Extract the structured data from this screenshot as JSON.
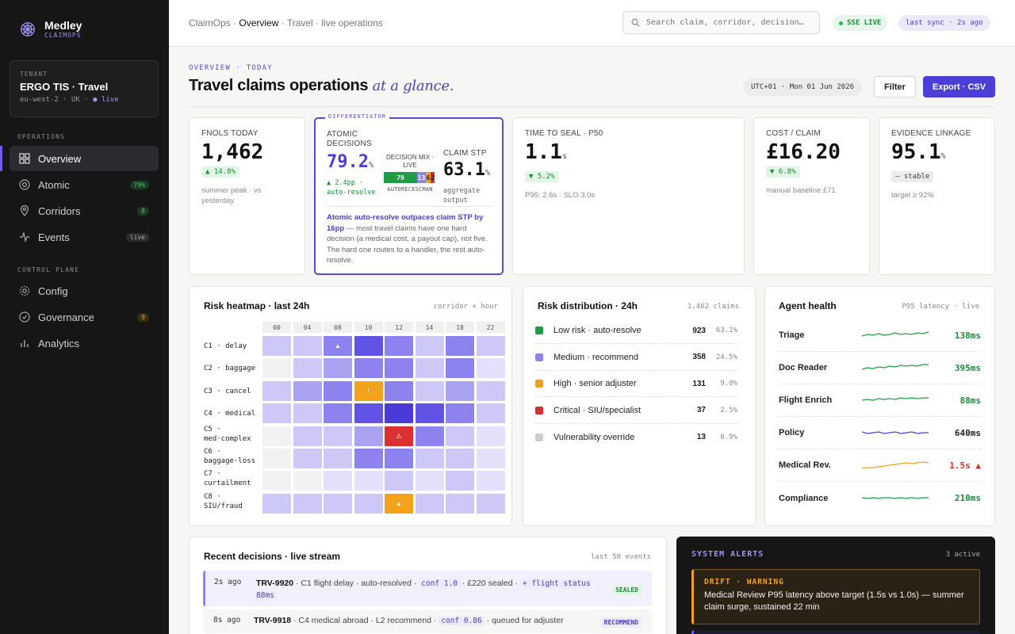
{
  "brand": {
    "name": "Medley",
    "sub": "CLAIMOPS"
  },
  "tenant": {
    "label": "TENANT",
    "name": "ERGO TIS · Travel",
    "region": "eu-west-2 · UK · ",
    "status": "live"
  },
  "nav": {
    "sections": [
      "OPERATIONS",
      "CONTROL PLANE"
    ],
    "items": [
      {
        "label": "Overview",
        "icon": "grid-icon"
      },
      {
        "label": "Atomic",
        "icon": "target-icon",
        "badge": "79%"
      },
      {
        "label": "Corridors",
        "icon": "pin-icon",
        "badge": "8"
      },
      {
        "label": "Events",
        "icon": "pulse-icon",
        "badge": "live"
      },
      {
        "label": "Config",
        "icon": "gear-icon"
      },
      {
        "label": "Governance",
        "icon": "check-circle-icon",
        "badge": "9"
      },
      {
        "label": "Analytics",
        "icon": "bar-chart-icon"
      }
    ]
  },
  "header": {
    "crumb_root": "ClaimOps ·",
    "crumb_current": "Overview",
    "crumb_tail": "· Travel · live operations",
    "search_placeholder": "Search claim, corridor, decision…",
    "live_pill": "SSE LIVE",
    "sync_pill": "last sync · 2s ago"
  },
  "page": {
    "eyebrow": "OVERVIEW · TODAY",
    "title": "Travel claims operations",
    "title_italic": "at a glance.",
    "date": "UTC+01 · Mon 01 Jun 2026",
    "filter_label": "Filter",
    "export_label": "Export · CSV"
  },
  "kpis": {
    "fnols": {
      "label": "FNOLS TODAY",
      "value": "1,462",
      "delta": "▲ 14.8%",
      "note": "summer peak · vs yesterday"
    },
    "atomic": {
      "tag": "DIFFERENTIATOR",
      "label": "ATOMIC DECISIONS",
      "value": "79.2",
      "unit": "%",
      "delta": "▲ 2.4pp · auto-resolve",
      "mix_label": "DECISION MIX · LIVE",
      "mix": [
        {
          "v": "79",
          "c": "#1f9d45"
        },
        {
          "v": "13",
          "c": "#8e86e8"
        },
        {
          "v": "6",
          "c": "#f0a020"
        },
        {
          "v": "2",
          "c": "#d63030"
        }
      ],
      "mix_axis": "AUTORECESCMAN",
      "stp_label": "CLAIM STP",
      "stp_value": "63.1",
      "stp_unit": "%",
      "stp_note": "aggregate output",
      "insight_strong": "Atomic auto-resolve outpaces claim STP by 16pp",
      "insight_rest": " — most travel claims have one hard decision (a medical cost, a payout cap), not five. The hard one routes to a handler, the rest auto-resolve."
    },
    "seal": {
      "label": "TIME TO SEAL · P50",
      "value": "1.1",
      "unit": "s",
      "delta": "▼ 5.2%",
      "note": "P95: 2.6s · SLO 3.0s"
    },
    "cost": {
      "label": "COST / CLAIM",
      "value": "£16.20",
      "delta": "▼ 6.8%",
      "note": "manual baseline £71"
    },
    "evidence": {
      "label": "EVIDENCE LINKAGE",
      "value": "95.1",
      "unit": "%",
      "delta": "– stable",
      "note": "target ≥ 92%"
    }
  },
  "heatmap": {
    "title": "Risk heatmap · last 24h",
    "meta": "corridor × hour",
    "cols": [
      "00",
      "04",
      "08",
      "10",
      "12",
      "14",
      "18",
      "22"
    ],
    "rows": [
      {
        "label": "C1 · delay",
        "cells": [
          2,
          2,
          4,
          5,
          4,
          2,
          4,
          2
        ],
        "marks": {
          "2": "▲"
        }
      },
      {
        "label": "C2 · baggage",
        "cells": [
          0,
          2,
          3,
          4,
          4,
          2,
          4,
          1
        ],
        "marks": {}
      },
      {
        "label": "C3 · cancel",
        "cells": [
          2,
          3,
          4,
          "a",
          4,
          2,
          3,
          2
        ],
        "marks": {
          "3": "!"
        }
      },
      {
        "label": "C4 · medical",
        "cells": [
          2,
          2,
          4,
          5,
          6,
          5,
          4,
          2
        ],
        "marks": {}
      },
      {
        "label": "C5 · med·complex",
        "cells": [
          0,
          2,
          2,
          3,
          "r",
          4,
          2,
          1
        ],
        "marks": {
          "4": "⚠"
        }
      },
      {
        "label": "C6 · baggage·loss",
        "cells": [
          0,
          2,
          2,
          4,
          4,
          2,
          2,
          1
        ],
        "marks": {}
      },
      {
        "label": "C7 · curtailment",
        "cells": [
          0,
          0,
          1,
          1,
          2,
          1,
          2,
          1
        ],
        "marks": {}
      },
      {
        "label": "C8 · SIU/fraud",
        "cells": [
          2,
          2,
          2,
          2,
          "a",
          2,
          2,
          2
        ],
        "marks": {
          "4": "▲"
        }
      }
    ]
  },
  "risk": {
    "title": "Risk distribution · 24h",
    "meta": "1,462 claims",
    "rows": [
      {
        "label": "Low risk · auto-resolve",
        "n": "923",
        "p": "63.1%",
        "color": "#1f9d45"
      },
      {
        "label": "Medium · recommend",
        "n": "358",
        "p": "24.5%",
        "color": "#8e86e8"
      },
      {
        "label": "High · senior adjuster",
        "n": "131",
        "p": "9.0%",
        "color": "#f0a020"
      },
      {
        "label": "Critical · SIU/specialist",
        "n": "37",
        "p": "2.5%",
        "color": "#d63030"
      },
      {
        "label": "Vulnerability override",
        "n": "13",
        "p": "0.9%",
        "color": "#cccccc"
      }
    ]
  },
  "agents": {
    "title": "Agent health",
    "meta": "P95 latency · live",
    "rows": [
      {
        "name": "Triage",
        "lat": "138ms",
        "color": "#1f9d45"
      },
      {
        "name": "Doc Reader",
        "lat": "395ms",
        "color": "#1f9d45"
      },
      {
        "name": "Flight Enrich",
        "lat": "88ms",
        "color": "#1f9d45"
      },
      {
        "name": "Policy",
        "lat": "640ms",
        "color": "#4b3fd8"
      },
      {
        "name": "Medical Rev.",
        "lat": "1.5s ▲",
        "color": "#f0a020"
      },
      {
        "name": "Compliance",
        "lat": "210ms",
        "color": "#1f9d45"
      }
    ]
  },
  "decisions": {
    "title": "Recent decisions · live stream",
    "meta": "last 50 events",
    "rows": [
      {
        "ago": "2s ago",
        "id": "TRV-9920",
        "desc": " · C1 flight delay · auto-resolved · ",
        "conf": "conf 1.0",
        "tail": " · £220 sealed · ",
        "extra": "+ flight status 88ms",
        "tag": "SEALED"
      },
      {
        "ago": "8s ago",
        "id": "TRV-9918",
        "desc": " · C4 medical abroad · L2 recommend · ",
        "conf": "conf 0.86",
        "tail": " · queued for adjuster",
        "extra": "",
        "tag": "RECOMMEND"
      }
    ]
  },
  "alerts": {
    "title": "SYSTEM ALERTS",
    "meta": "3 active",
    "items": [
      {
        "kind": "DRIFT · WARNING",
        "text": "Medical Review P95 latency above target (1.5s vs 1.0s) — summer claim surge, sustained 22 min"
      }
    ]
  }
}
